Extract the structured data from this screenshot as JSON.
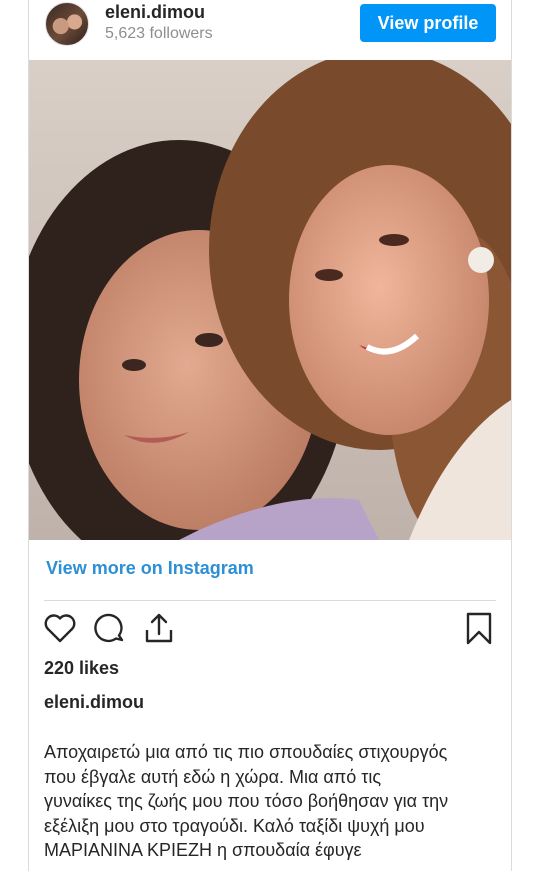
{
  "header": {
    "username": "eleni.dimou",
    "followers": "5,623 followers",
    "view_profile_label": "View profile"
  },
  "post": {
    "view_more_label": "View more on Instagram",
    "likes": "220 likes",
    "caption_user": "eleni.dimou",
    "caption_lines": [
      "Αποχαιρετώ μια από τις πιο σπουδαίες στιχουργός",
      "που έβγαλε αυτή εδώ η χώρα. Μια από τις",
      "γυναίκες της ζωής μου που τόσο βοήθησαν για την",
      "εξέλιξη μου στο τραγούδι. Καλό ταξίδι ψυχή μου",
      "ΜΑΡΙΑΝΙΝΑ ΚΡΙΕΖΗ η σπουδαία έφυγε"
    ]
  },
  "icons": {
    "like": "heart-icon",
    "comment": "comment-icon",
    "share": "share-icon",
    "save": "bookmark-icon"
  },
  "colors": {
    "accent": "#0095f6",
    "link": "#2d8fd5",
    "muted": "#8e8e8e",
    "text": "#262626"
  }
}
